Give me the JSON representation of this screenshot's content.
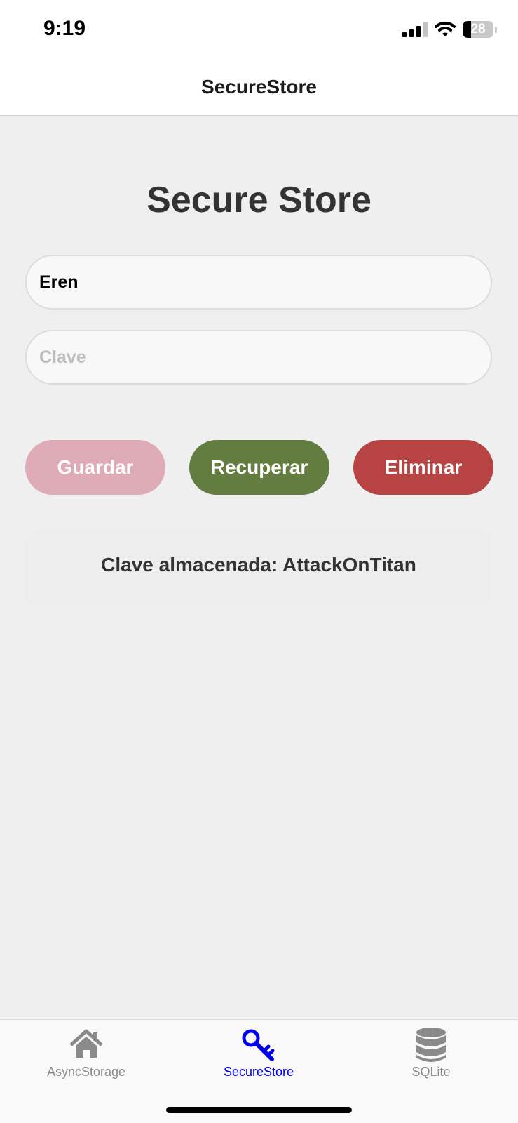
{
  "status_bar": {
    "time": "9:19",
    "battery_level": "28",
    "battery_fraction": 0.28,
    "icons": [
      "cellular-signal-icon",
      "wifi-icon",
      "battery-icon"
    ]
  },
  "header": {
    "title": "SecureStore"
  },
  "main": {
    "title": "Secure Store",
    "user_field": {
      "value": "Eren",
      "placeholder": ""
    },
    "key_field": {
      "value": "",
      "placeholder": "Clave"
    },
    "buttons": {
      "save": "Guardar",
      "retrieve": "Recuperar",
      "delete": "Eliminar"
    },
    "result": "Clave almacenada: AttackOnTitan"
  },
  "tabs": [
    {
      "label": "AsyncStorage",
      "icon": "home-icon",
      "active": false
    },
    {
      "label": "SecureStore",
      "icon": "key-icon",
      "active": true
    },
    {
      "label": "SQLite",
      "icon": "database-icon",
      "active": false
    }
  ],
  "colors": {
    "save_button": "#dfabb6",
    "retrieve_button": "#627d3f",
    "delete_button": "#b84343",
    "active_tab": "#0000ee",
    "inactive_tab": "#8a8a8a",
    "content_background": "#efefef"
  }
}
